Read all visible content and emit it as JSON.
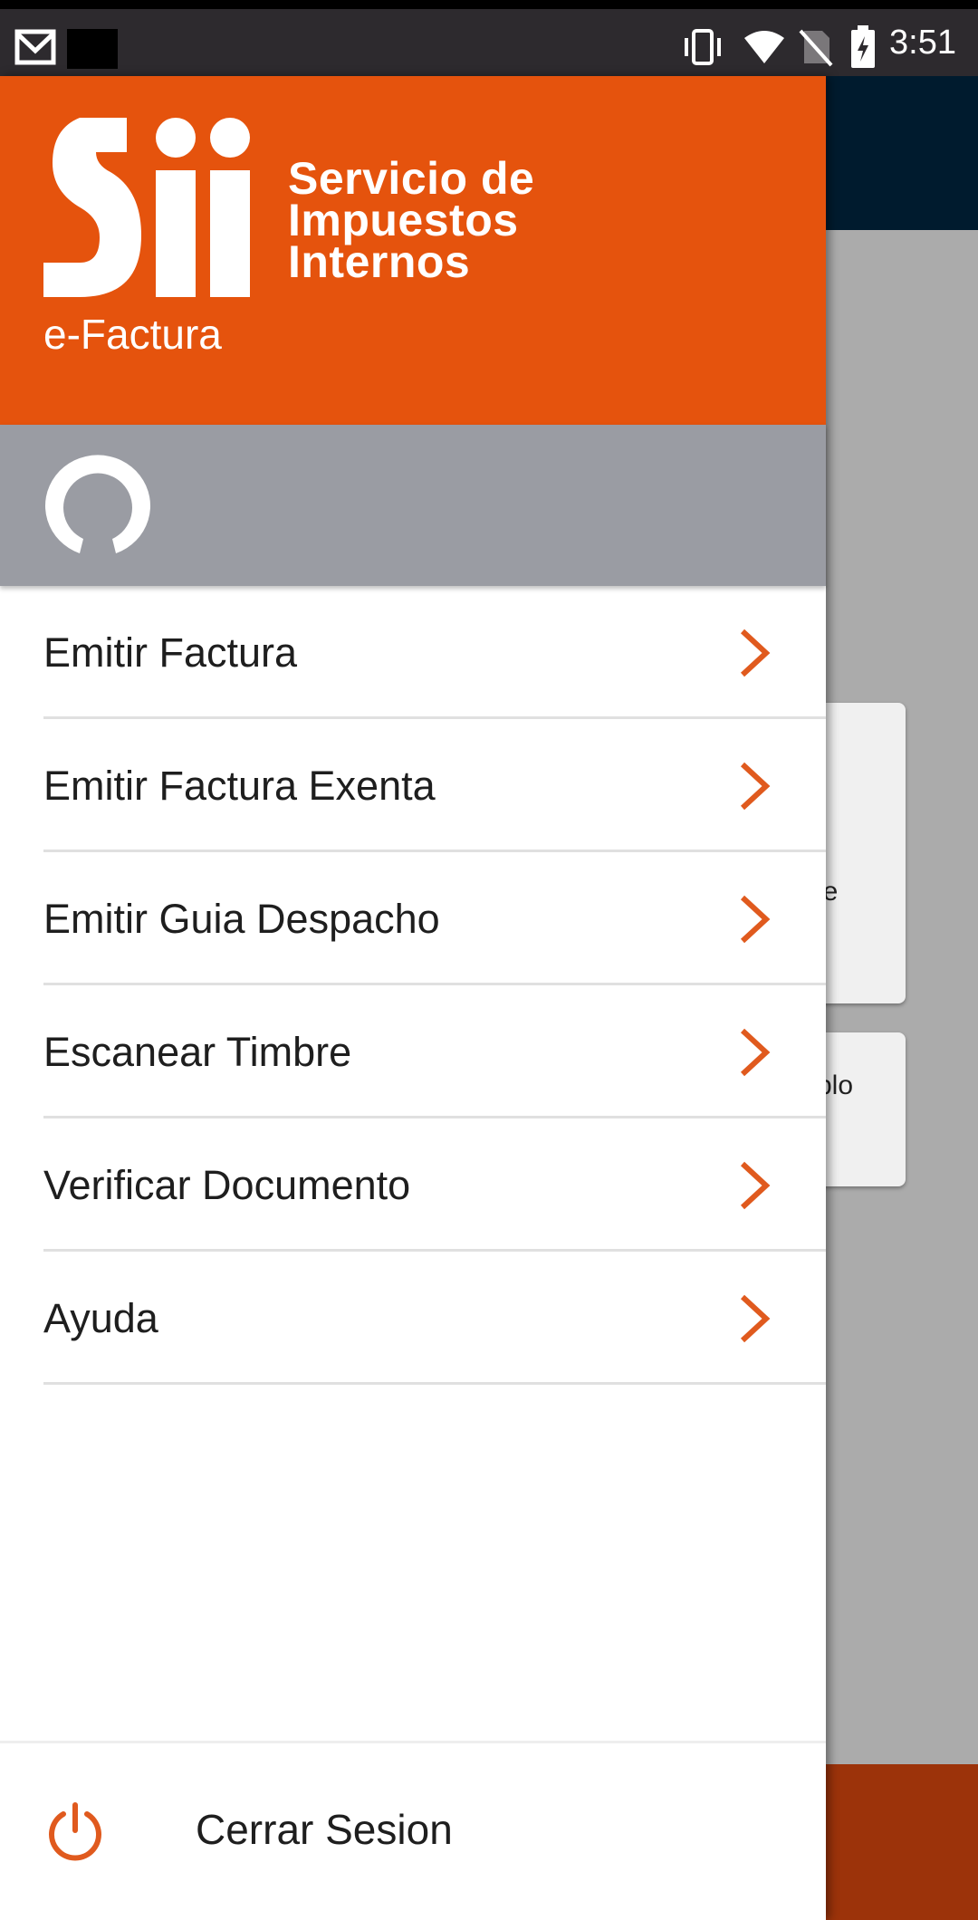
{
  "status_bar": {
    "time": "3:51",
    "icons": [
      "gmail-icon",
      "vibrate-icon",
      "wifi-icon",
      "no-sim-icon",
      "battery-charging-icon"
    ]
  },
  "drawer": {
    "header": {
      "logo_name": "sii-logo",
      "logo_lines": [
        "Servicio de",
        "Impuestos",
        "Internos"
      ],
      "app_name": "e-Factura",
      "color": "#e5530d"
    },
    "user": {
      "avatar_icon": "user-avatar-icon",
      "band_color": "#9a9ca3"
    },
    "menu": [
      {
        "label": "Emitir Factura",
        "icon": "chevron-right-icon"
      },
      {
        "label": "Emitir Factura Exenta",
        "icon": "chevron-right-icon"
      },
      {
        "label": "Emitir Guia Despacho",
        "icon": "chevron-right-icon"
      },
      {
        "label": "Escanear Timbre",
        "icon": "chevron-right-icon"
      },
      {
        "label": "Verificar Documento",
        "icon": "chevron-right-icon"
      },
      {
        "label": "Ayuda",
        "icon": "chevron-right-icon"
      }
    ],
    "footer": {
      "label": "Cerrar Sesion",
      "icon": "power-icon"
    },
    "accent_color": "#e5530d"
  },
  "background": {
    "card1_text": "le",
    "card2_text": "plo"
  }
}
